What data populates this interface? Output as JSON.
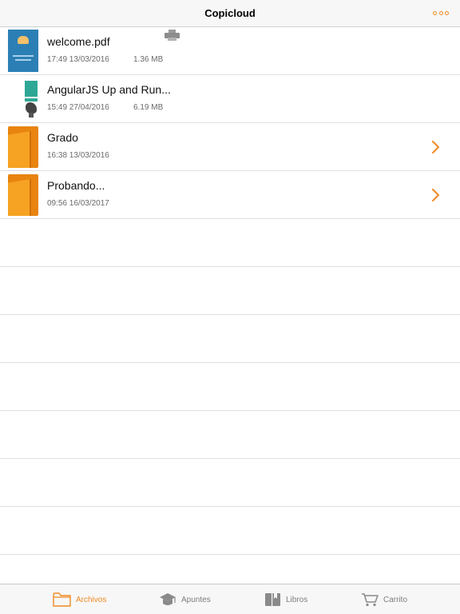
{
  "header": {
    "title": "Copicloud",
    "more_icon": "more-icon",
    "accent": "#f08a24"
  },
  "files": [
    {
      "name": "welcome.pdf",
      "date": "17:49 13/03/2016",
      "size": "1.36 MB",
      "icon": "pdf-thumbnail",
      "print_icon": "print-icon"
    },
    {
      "name": "AngularJS Up and Run...",
      "date": "15:49 27/04/2016",
      "size": "6.19 MB",
      "icon": "book-thumbnail"
    }
  ],
  "folders": [
    {
      "name": "Grado",
      "date": "16:38 13/03/2016",
      "icon": "folder-icon"
    },
    {
      "name": "Probando...",
      "date": "09:56 16/03/2017",
      "icon": "folder-icon"
    }
  ],
  "tabbar": {
    "tabs": [
      {
        "label": "Archivos",
        "icon": "folder-outline-icon",
        "active": true
      },
      {
        "label": "Apuntes",
        "icon": "graduation-cap-icon",
        "active": false
      },
      {
        "label": "Libros",
        "icon": "book-icon",
        "active": false
      },
      {
        "label": "Carrito",
        "icon": "cart-icon",
        "active": false
      }
    ]
  }
}
